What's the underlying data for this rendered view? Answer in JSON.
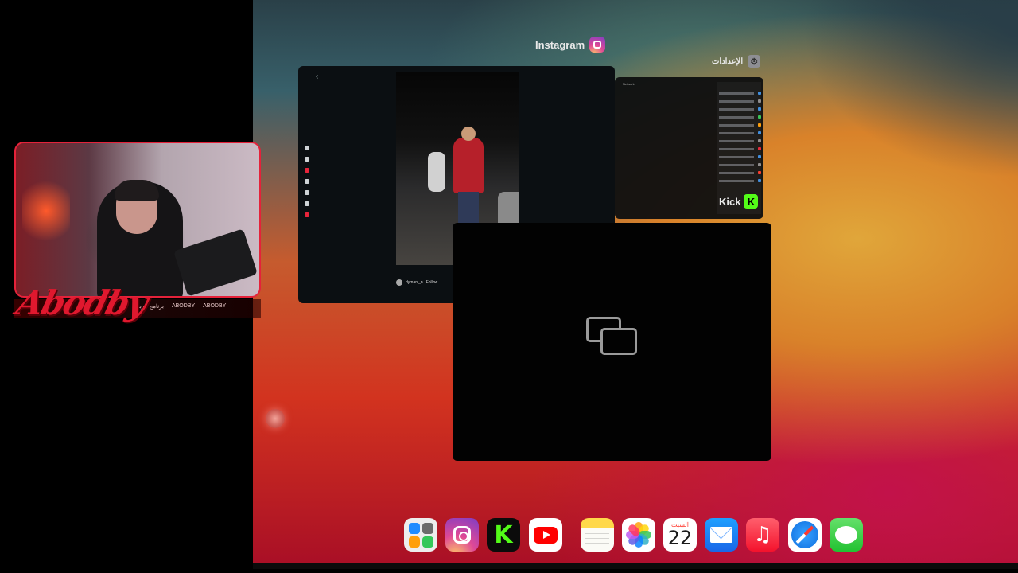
{
  "streamer": {
    "logo_text": "Abodby",
    "bar_items": [
      "برنامج عربي",
      "ABODBY",
      "ABODBY"
    ]
  },
  "app_switcher": {
    "instagram_label": "Instagram",
    "settings_label": "الإعدادات",
    "kick_label": "Kick",
    "kick_icon_glyph": "K",
    "instagram_card": {
      "back_glyph": "‹",
      "username": "dymanl_n",
      "follow": "Follow"
    },
    "settings_card": {
      "header": "Network"
    }
  },
  "dock": {
    "apps": [
      {
        "name": "App Store",
        "icon": "appstore-icon"
      },
      {
        "name": "Instagram",
        "icon": "instagram-icon"
      },
      {
        "name": "Kick",
        "icon": "kick-icon",
        "glyph": "K"
      },
      {
        "name": "YouTube",
        "icon": "youtube-icon"
      },
      {
        "name": "Notes",
        "icon": "notes-icon"
      },
      {
        "name": "Photos",
        "icon": "photos-icon"
      },
      {
        "name": "Calendar",
        "icon": "calendar-icon",
        "day": "السبت",
        "date": "22"
      },
      {
        "name": "Mail",
        "icon": "mail-icon"
      },
      {
        "name": "Music",
        "icon": "music-icon",
        "glyph": "♫"
      },
      {
        "name": "Safari",
        "icon": "safari-icon"
      },
      {
        "name": "Messages",
        "icon": "messages-icon"
      }
    ]
  },
  "colors": {
    "kick_green": "#53fc18",
    "streamer_red": "#e4223a",
    "ios_red": "#ff3b30"
  }
}
